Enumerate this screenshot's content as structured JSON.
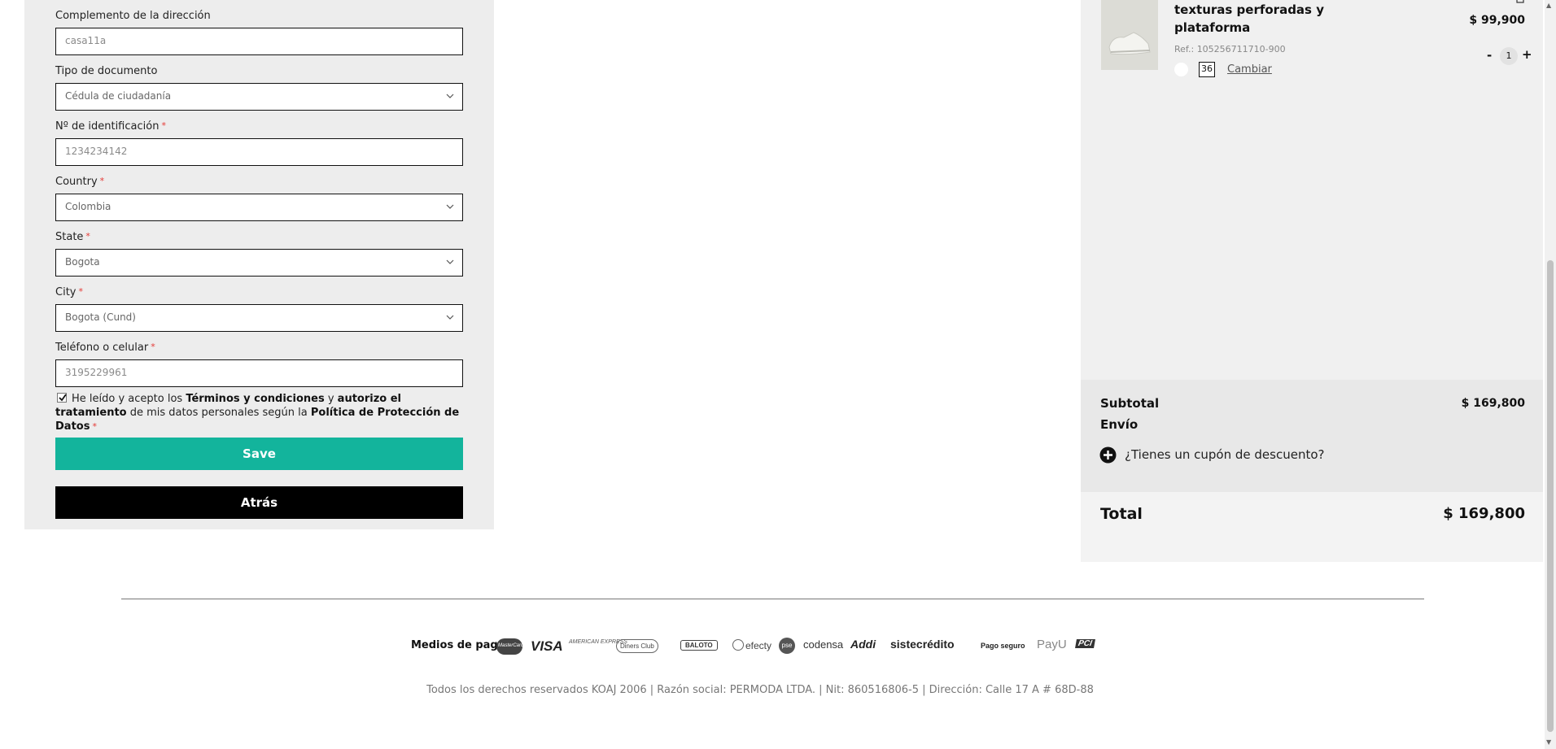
{
  "form": {
    "address_complement": {
      "label": "Complemento de la dirección",
      "value": "casa11a"
    },
    "document_type": {
      "label": "Tipo de documento",
      "value": "Cédula de ciudadanía"
    },
    "id_number": {
      "label": "Nº de identificación",
      "required_mark": "*",
      "value": "1234234142"
    },
    "country": {
      "label": "Country",
      "required_mark": "*",
      "value": "Colombia"
    },
    "state": {
      "label": "State",
      "required_mark": "*",
      "value": "Bogota"
    },
    "city": {
      "label": "City",
      "required_mark": "*",
      "value": "Bogota (Cund)"
    },
    "phone": {
      "label": "Teléfono o celular",
      "required_mark": "*",
      "value": "3195229961"
    },
    "consent": {
      "checked": true,
      "part1": "He leído y acepto los ",
      "terms": "Términos y condiciones",
      "part2": " y ",
      "authorize": "autorizo el tratamiento",
      "part3": " de mis datos personales según la ",
      "policy": "Política de Protección de Datos",
      "required_mark": "*"
    },
    "save_label": "Save",
    "back_label": "Atrás"
  },
  "cart": {
    "item": {
      "title": "texturas perforadas y plataforma",
      "ref": "Ref.: 105256711710-900",
      "price": "$ 99,900",
      "quantity": "1",
      "minus": "-",
      "plus": "+",
      "size": "36",
      "change_label": "Cambiar"
    },
    "summary": {
      "subtotal_label": "Subtotal",
      "subtotal_value": "$ 169,800",
      "shipping_label": "Envío",
      "coupon_label": "¿Tienes un cupón de descuento?",
      "total_label": "Total",
      "total_value": "$ 169,800"
    }
  },
  "footer": {
    "payment_title": "Medios de pago",
    "logos": {
      "mastercard": "MasterCard",
      "visa": "VISA",
      "amex": "AMERICAN EXPRESS",
      "diners": "Diners Club",
      "baloto": "BALOTO",
      "efecty": "efecty",
      "pse": "pse",
      "codensa": "codensa",
      "addi": "Addi",
      "sistecredito": "sistecrédito",
      "secure": "Pago seguro",
      "payu": "PayU",
      "pci": "PCI"
    },
    "copyright": "Todos los derechos reservados KOAJ 2006 | Razón social: PERMODA LTDA. | Nit: 860516806-5 | Dirección: Calle 17 A # 68D-88"
  },
  "colors": {
    "accent": "#13b49c",
    "back_button": "#000000",
    "required": "#e53935"
  }
}
